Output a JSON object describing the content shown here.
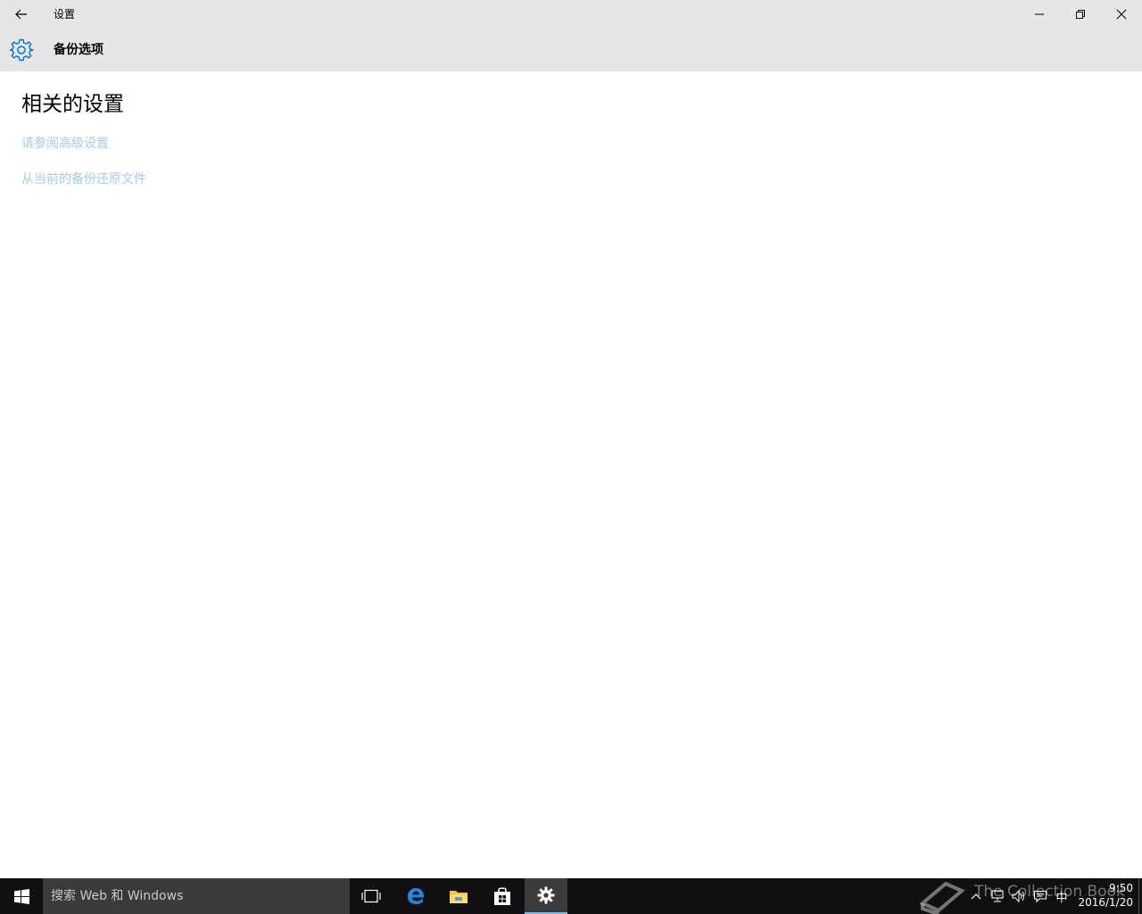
{
  "window": {
    "title": "设置",
    "back_icon": "back-arrow-icon",
    "controls": [
      "minimize-icon",
      "restore-icon",
      "close-icon"
    ]
  },
  "header": {
    "icon": "gear-icon",
    "title": "备份选项",
    "accent_color": "#0078d7"
  },
  "content": {
    "section_title": "相关的设置",
    "links": [
      {
        "label": "请参阅高级设置"
      },
      {
        "label": "从当前的备份还原文件"
      }
    ],
    "link_color": "#a9cbe4"
  },
  "taskbar": {
    "search_placeholder": "搜索 Web 和 Windows",
    "pinned": [
      "task-view-icon",
      "edge-icon",
      "file-explorer-icon",
      "store-icon",
      "settings-icon"
    ],
    "active_app": "settings-icon",
    "tray": {
      "ime": "中",
      "time": "9:50",
      "date": "2016/1/20"
    },
    "watermark_text": "The Collection Book"
  }
}
